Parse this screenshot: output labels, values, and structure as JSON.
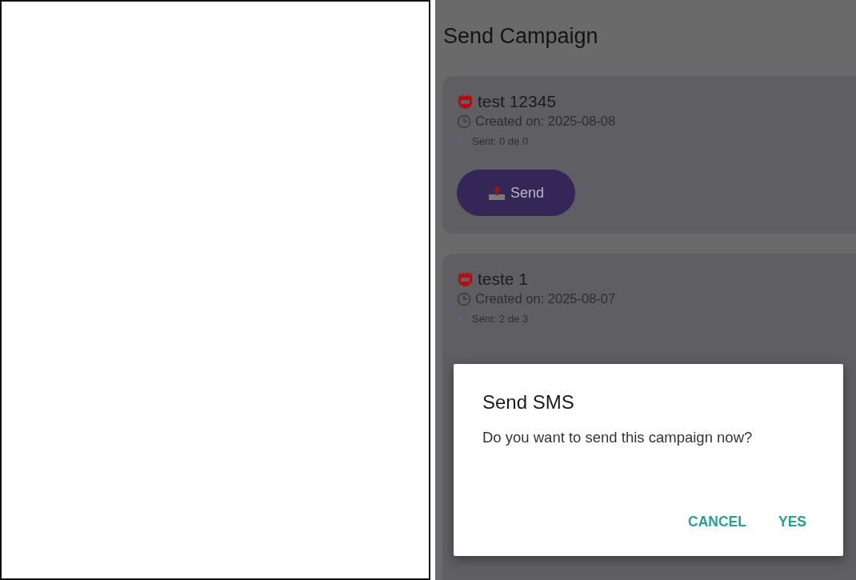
{
  "screen": {
    "title": "Send Campaign"
  },
  "campaigns": [
    {
      "name": "test 12345",
      "created": "Created on: 2025-08-08",
      "sent": "Sent: 0 de 0",
      "button": "Send"
    },
    {
      "name": "teste 1",
      "created": "Created on: 2025-08-07",
      "sent": "Sent: 2 de 3"
    }
  ],
  "dialog": {
    "title": "Send SMS",
    "message": "Do you want to send this campaign now?",
    "buttons": [
      "CANCEL",
      "YES"
    ]
  }
}
